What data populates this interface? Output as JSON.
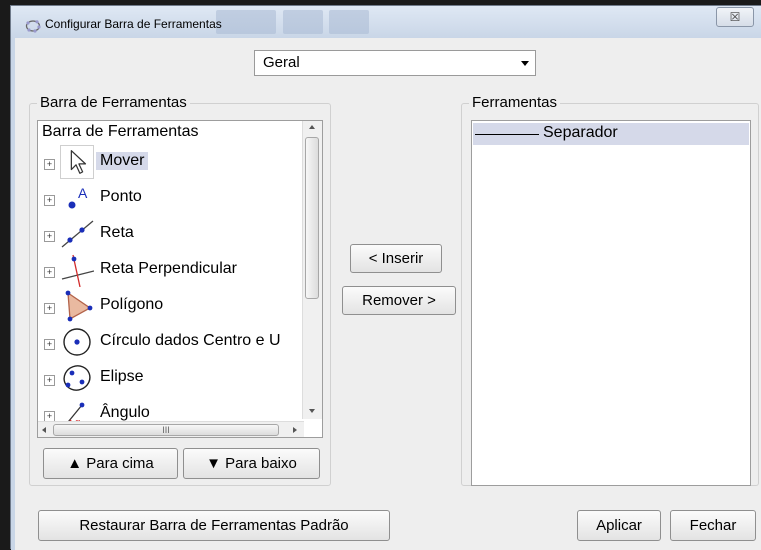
{
  "window": {
    "title": "Configurar Barra de Ferramentas",
    "close_glyph": "☒"
  },
  "dropdown": {
    "selected": "Geral"
  },
  "left_panel": {
    "group_label": "Barra de Ferramentas",
    "tree_root": "Barra de Ferramentas",
    "items": [
      {
        "label": "Mover",
        "icon": "move-cursor-icon"
      },
      {
        "label": "Ponto",
        "icon": "point-icon"
      },
      {
        "label": "Reta",
        "icon": "line-icon"
      },
      {
        "label": "Reta Perpendicular",
        "icon": "perpendicular-line-icon"
      },
      {
        "label": "Polígono",
        "icon": "polygon-icon"
      },
      {
        "label": "Círculo dados Centro e U",
        "icon": "circle-center-point-icon"
      },
      {
        "label": "Elipse",
        "icon": "ellipse-icon"
      },
      {
        "label": "Ângulo",
        "icon": "angle-icon"
      }
    ],
    "hscroll_grip": "III",
    "up_button": "▲ Para cima",
    "down_button": "▼ Para baixo"
  },
  "middle": {
    "insert_button": "< Inserir",
    "remove_button": "Remover >"
  },
  "right_panel": {
    "group_label": "Ferramentas",
    "items": [
      {
        "label": "Separador"
      }
    ]
  },
  "footer": {
    "restore_button": "Restaurar Barra de Ferramentas Padrão",
    "apply_button": "Aplicar",
    "close_button": "Fechar"
  },
  "colors": {
    "selection": "#d5d9e9",
    "point_blue": "#1a2eb8",
    "accent_red": "#d22b2b"
  }
}
